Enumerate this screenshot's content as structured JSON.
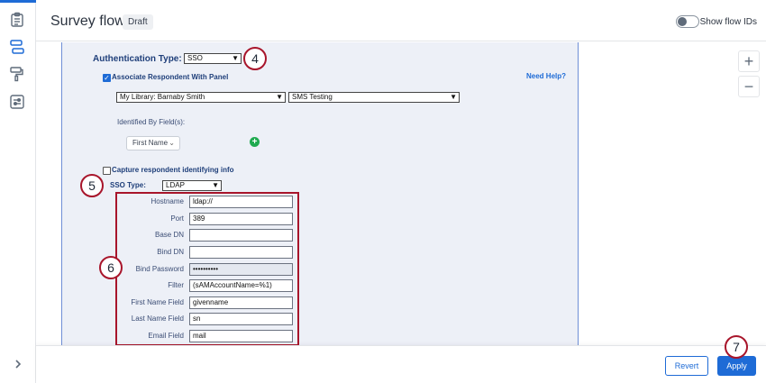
{
  "header": {
    "title": "Survey flow",
    "badge": "Draft",
    "toggle_label": "Show flow IDs"
  },
  "rail": {
    "icons": [
      "survey-icon",
      "flow-icon",
      "paint-roller-icon",
      "options-icon"
    ],
    "expand": "chevron-right-icon"
  },
  "zoom": {
    "in": "+",
    "out": "−"
  },
  "auth": {
    "type_label": "Authentication Type:",
    "type_value": "SSO",
    "associate_label": "Associate Respondent With Panel",
    "help_link": "Need Help?",
    "library_value": "My Library: Barnaby Smith",
    "panel_value": "SMS Testing",
    "identified_label": "Identified By Field(s):",
    "identified_chip": "First Name",
    "capture_label": "Capture respondent identifying info",
    "sso_type_label": "SSO Type:",
    "sso_type_value": "LDAP"
  },
  "fields": [
    {
      "label": "Hostname",
      "value": "ldap://"
    },
    {
      "label": "Port",
      "value": "389"
    },
    {
      "label": "Base DN",
      "value": ""
    },
    {
      "label": "Bind DN",
      "value": ""
    },
    {
      "label": "Bind Password",
      "value": "••••••••••"
    },
    {
      "label": "Filter",
      "value": "(sAMAccountName=%1)"
    },
    {
      "label": "First Name Field",
      "value": "givenname"
    },
    {
      "label": "Last Name Field",
      "value": "sn"
    },
    {
      "label": "Email Field",
      "value": "mail"
    }
  ],
  "steps": {
    "s4": "4",
    "s5": "5",
    "s6": "6",
    "s7": "7"
  },
  "footer": {
    "revert": "Revert",
    "apply": "Apply"
  },
  "colors": {
    "accent": "#1e6bd6",
    "callout": "#a8152b",
    "panel_bg": "#edf0f7"
  }
}
